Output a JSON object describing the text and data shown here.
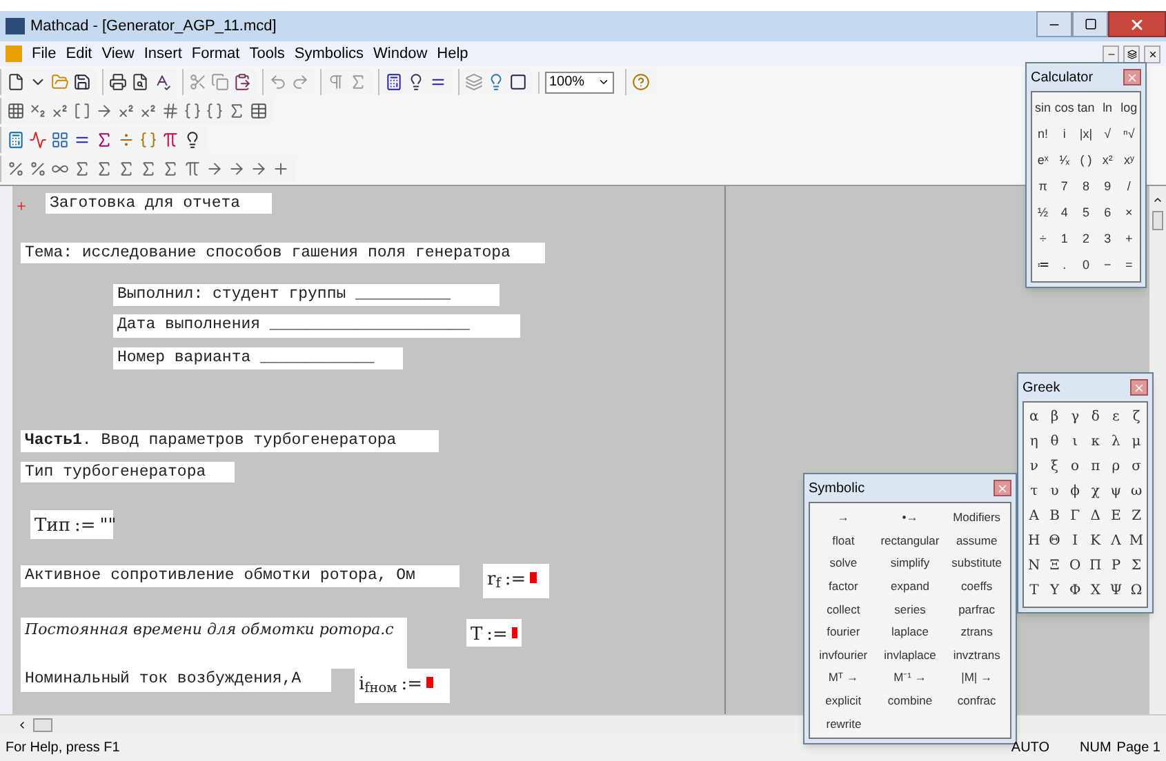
{
  "window": {
    "title": "Mathcad - [Generator_AGP_11.mcd]"
  },
  "menu": [
    "File",
    "Edit",
    "View",
    "Insert",
    "Format",
    "Tools",
    "Symbolics",
    "Window",
    "Help"
  ],
  "toolbar": {
    "zoom": "100%"
  },
  "worksheet": {
    "texts": [
      {
        "kind": "text",
        "text": "Заготовка для отчета"
      },
      {
        "kind": "text",
        "text": "Тема: исследование способов гашения поля генератора"
      },
      {
        "kind": "text",
        "text": "Выполнил: студент группы __________"
      },
      {
        "kind": "text",
        "text": "Дата выполнения _____________________"
      },
      {
        "kind": "text",
        "text": "Номер варианта ____________"
      },
      {
        "kind": "text",
        "text": "**Часть1**. Ввод параметров турбогенератора"
      },
      {
        "kind": "text",
        "text": "Тип турбогенератора"
      },
      {
        "kind": "math",
        "name": "Тип",
        "op": ":=",
        "value": "\"\""
      },
      {
        "kind": "text",
        "text": "Активное сопротивление обмотки ротора, Ом"
      },
      {
        "kind": "math",
        "name": "r$_{f}$",
        "op": ":="
      },
      {
        "kind": "script",
        "text": "Постоянная времени для обмотки ротора.с"
      },
      {
        "kind": "math",
        "name": "T",
        "op": ":="
      },
      {
        "kind": "text",
        "text": "Номинальный ток возбуждения,А"
      },
      {
        "kind": "math",
        "name": "i$_{fном}$",
        "op": ":="
      }
    ]
  },
  "calculator": {
    "title": "Calculator",
    "keys": [
      [
        "sin",
        "cos",
        "tan",
        "ln",
        "log"
      ],
      [
        "n!",
        "i",
        "|x|",
        "√",
        "ⁿ√"
      ],
      [
        "eˣ",
        "¹⁄ₓ",
        "( )",
        "x²",
        "xʸ"
      ],
      [
        "π",
        "7",
        "8",
        "9",
        "/"
      ],
      [
        "½",
        "4",
        "5",
        "6",
        "×"
      ],
      [
        "÷",
        "1",
        "2",
        "3",
        "+"
      ],
      [
        "≔",
        ".",
        "0",
        "−",
        "="
      ]
    ]
  },
  "greek": {
    "title": "Greek",
    "keys": [
      [
        "α",
        "β",
        "γ",
        "δ",
        "ε",
        "ζ"
      ],
      [
        "η",
        "θ",
        "ι",
        "κ",
        "λ",
        "μ"
      ],
      [
        "ν",
        "ξ",
        "ο",
        "π",
        "ρ",
        "σ"
      ],
      [
        "τ",
        "υ",
        "ϕ",
        "χ",
        "ψ",
        "ω"
      ],
      [
        "Α",
        "Β",
        "Γ",
        "Δ",
        "Ε",
        "Ζ"
      ],
      [
        "Η",
        "Θ",
        "Ι",
        "Κ",
        "Λ",
        "Μ"
      ],
      [
        "Ν",
        "Ξ",
        "Ο",
        "Π",
        "Ρ",
        "Σ"
      ],
      [
        "Τ",
        "Υ",
        "Φ",
        "Χ",
        "Ψ",
        "Ω"
      ]
    ]
  },
  "symbolic": {
    "title": "Symbolic",
    "keys": [
      [
        "→",
        "•→",
        "Modifiers"
      ],
      [
        "float",
        "rectangular",
        "assume"
      ],
      [
        "solve",
        "simplify",
        "substitute"
      ],
      [
        "factor",
        "expand",
        "coeffs"
      ],
      [
        "collect",
        "series",
        "parfrac"
      ],
      [
        "fourier",
        "laplace",
        "ztrans"
      ],
      [
        "invfourier",
        "invlaplace",
        "invztrans"
      ],
      [
        "Mᵀ →",
        "M⁻¹ →",
        "|M| →"
      ],
      [
        "explicit",
        "combine",
        "confrac"
      ],
      [
        "rewrite"
      ]
    ]
  },
  "status_bar": [
    "For Help, press F1",
    "AUTO",
    "NUM",
    "Page 1"
  ]
}
